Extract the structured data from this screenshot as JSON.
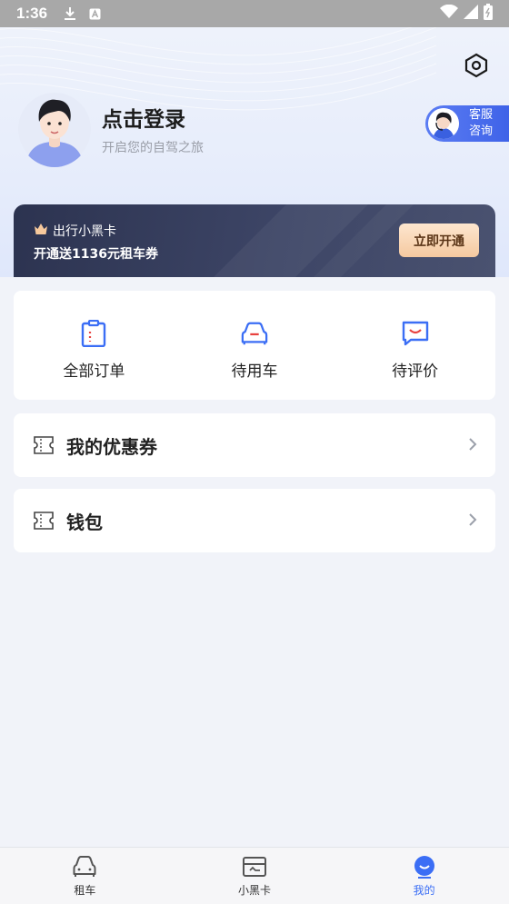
{
  "status_bar": {
    "time": "1:36"
  },
  "header": {
    "login_title": "点击登录",
    "login_subtitle": "开启您的自驾之旅",
    "service_line1": "客服",
    "service_line2": "咨询"
  },
  "vip_card": {
    "title": "出行小黑卡",
    "description": "开通送1136元租车券",
    "button_label": "立即开通"
  },
  "orders": [
    {
      "label": "全部订单",
      "icon": "clipboard-icon"
    },
    {
      "label": "待用车",
      "icon": "car-icon"
    },
    {
      "label": "待评价",
      "icon": "comment-icon"
    }
  ],
  "menu_rows": [
    {
      "label": "我的优惠券",
      "icon": "coupon-icon"
    },
    {
      "label": "钱包",
      "icon": "wallet-icon"
    }
  ],
  "tabbar": [
    {
      "label": "租车",
      "icon": "car-tab-icon",
      "active": false
    },
    {
      "label": "小黑卡",
      "icon": "card-tab-icon",
      "active": false
    },
    {
      "label": "我的",
      "icon": "profile-tab-icon",
      "active": true
    }
  ],
  "colors": {
    "accent": "#3b6ef5",
    "vip_dark": "#2c3350",
    "vip_button": "#f5c9a0",
    "icon_red": "#e8423f"
  }
}
